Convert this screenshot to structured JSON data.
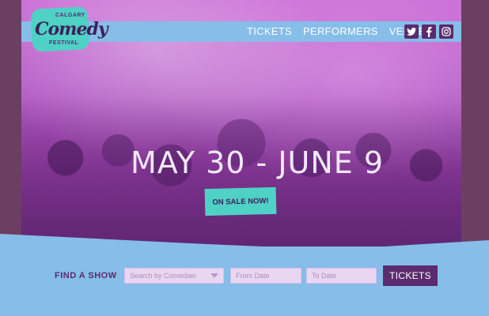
{
  "logo": {
    "top_text": "CALGARY",
    "word": "Comedy",
    "bottom_text": "FESTIVAL"
  },
  "nav": {
    "links": [
      "TICKETS",
      "PERFORMERS",
      "VENUES"
    ],
    "social": [
      "twitter-icon",
      "facebook-icon",
      "instagram-icon"
    ]
  },
  "hero": {
    "dates": "MAY 30 - JUNE 9",
    "cta_label": "ON SALE NOW!"
  },
  "search": {
    "label": "FIND A SHOW",
    "comedian_placeholder": "Search by Comedian",
    "from_placeholder": "From Date",
    "to_placeholder": "To Date",
    "button_label": "TICKETS"
  },
  "colors": {
    "accent": "#4fd1c5",
    "brand_purple": "#5b2b6e",
    "light_blue": "#86bde9"
  }
}
